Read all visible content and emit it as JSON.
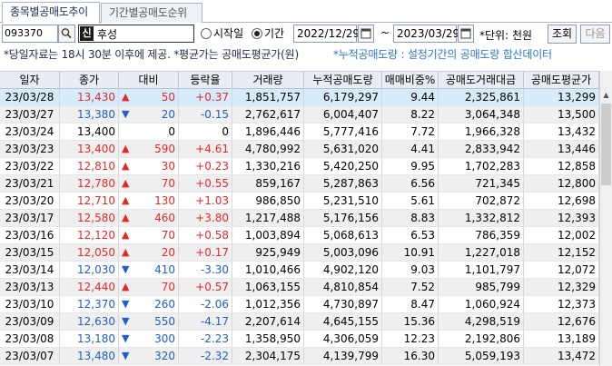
{
  "tabs": [
    {
      "label": "종목별공매도추이",
      "active": true
    },
    {
      "label": "기간별공매도순위",
      "active": false
    }
  ],
  "toolbar": {
    "code": "093370",
    "badge": "신",
    "name": "후성",
    "radio_start": "시작일",
    "radio_period": "기간",
    "date_from": "2022/12/29",
    "tilde": "~",
    "date_to": "2023/03/29",
    "unit": "*단위: 천원",
    "query_label": "조회",
    "next_label": "다음"
  },
  "info": {
    "left": "*당일자료는 18시 30분 이후에 제공. *평균가는 공매도평균가(원)",
    "right": "*누적공매도량 : 설정기간의 공매도량 합산데이터"
  },
  "colors": {
    "up": "#e22a2a",
    "down": "#1e5fc8",
    "selected_row": "#d6ebfb",
    "header_bg": "#e9edf3"
  },
  "table": {
    "columns": [
      "일자",
      "종가",
      "대비",
      "등락율",
      "거래량",
      "누적공매도량",
      "매매비중%",
      "공매도거래대금",
      "공매도평균가"
    ],
    "rows": [
      {
        "date": "23/03/28",
        "close": "13,430",
        "dir": "up",
        "diff": "50",
        "rate": "+0.37",
        "volume": "1,851,757",
        "cum": "6,179,297",
        "ratio": "9.44",
        "amount": "2,325,861",
        "avg": "13,299"
      },
      {
        "date": "23/03/27",
        "close": "13,380",
        "dir": "down",
        "diff": "20",
        "rate": "-0.15",
        "volume": "2,762,617",
        "cum": "6,004,407",
        "ratio": "8.22",
        "amount": "3,064,348",
        "avg": "13,500"
      },
      {
        "date": "23/03/24",
        "close": "13,400",
        "dir": "flat",
        "diff": "0",
        "rate": "0",
        "volume": "1,896,446",
        "cum": "5,777,416",
        "ratio": "7.72",
        "amount": "1,966,328",
        "avg": "13,432"
      },
      {
        "date": "23/03/23",
        "close": "13,400",
        "dir": "up",
        "diff": "590",
        "rate": "+4.61",
        "volume": "4,780,992",
        "cum": "5,631,020",
        "ratio": "4.41",
        "amount": "2,833,942",
        "avg": "13,446"
      },
      {
        "date": "23/03/22",
        "close": "12,810",
        "dir": "up",
        "diff": "30",
        "rate": "+0.23",
        "volume": "1,330,216",
        "cum": "5,420,250",
        "ratio": "9.95",
        "amount": "1,702,283",
        "avg": "12,858"
      },
      {
        "date": "23/03/21",
        "close": "12,780",
        "dir": "up",
        "diff": "70",
        "rate": "+0.55",
        "volume": "859,167",
        "cum": "5,287,863",
        "ratio": "6.56",
        "amount": "721,345",
        "avg": "12,800"
      },
      {
        "date": "23/03/20",
        "close": "12,710",
        "dir": "up",
        "diff": "130",
        "rate": "+1.03",
        "volume": "986,850",
        "cum": "5,231,510",
        "ratio": "5.61",
        "amount": "702,872",
        "avg": "12,698"
      },
      {
        "date": "23/03/17",
        "close": "12,580",
        "dir": "up",
        "diff": "460",
        "rate": "+3.80",
        "volume": "1,217,488",
        "cum": "5,176,156",
        "ratio": "8.83",
        "amount": "1,332,812",
        "avg": "12,393"
      },
      {
        "date": "23/03/16",
        "close": "12,120",
        "dir": "up",
        "diff": "70",
        "rate": "+0.58",
        "volume": "1,003,894",
        "cum": "5,068,613",
        "ratio": "6.53",
        "amount": "786,359",
        "avg": "12,002"
      },
      {
        "date": "23/03/15",
        "close": "12,050",
        "dir": "up",
        "diff": "20",
        "rate": "+0.17",
        "volume": "925,949",
        "cum": "5,003,096",
        "ratio": "10.91",
        "amount": "1,227,018",
        "avg": "12,152"
      },
      {
        "date": "23/03/14",
        "close": "12,030",
        "dir": "down",
        "diff": "410",
        "rate": "-3.30",
        "volume": "1,010,466",
        "cum": "4,902,120",
        "ratio": "9.03",
        "amount": "1,101,797",
        "avg": "12,072"
      },
      {
        "date": "23/03/13",
        "close": "12,440",
        "dir": "up",
        "diff": "70",
        "rate": "+0.57",
        "volume": "1,063,155",
        "cum": "4,810,854",
        "ratio": "7.52",
        "amount": "985,799",
        "avg": "12,329"
      },
      {
        "date": "23/03/10",
        "close": "12,370",
        "dir": "down",
        "diff": "260",
        "rate": "-2.06",
        "volume": "1,012,356",
        "cum": "4,730,897",
        "ratio": "8.47",
        "amount": "1,060,924",
        "avg": "12,373"
      },
      {
        "date": "23/03/09",
        "close": "12,630",
        "dir": "down",
        "diff": "550",
        "rate": "-4.17",
        "volume": "2,207,614",
        "cum": "4,645,155",
        "ratio": "15.36",
        "amount": "4,298,519",
        "avg": "12,676"
      },
      {
        "date": "23/03/08",
        "close": "13,180",
        "dir": "down",
        "diff": "300",
        "rate": "-2.23",
        "volume": "1,358,950",
        "cum": "4,306,059",
        "ratio": "12.23",
        "amount": "2,192,806",
        "avg": "13,189"
      },
      {
        "date": "23/03/07",
        "close": "13,480",
        "dir": "down",
        "diff": "320",
        "rate": "-2.32",
        "volume": "2,304,175",
        "cum": "4,139,799",
        "ratio": "16.30",
        "amount": "5,059,193",
        "avg": "13,472"
      }
    ]
  }
}
